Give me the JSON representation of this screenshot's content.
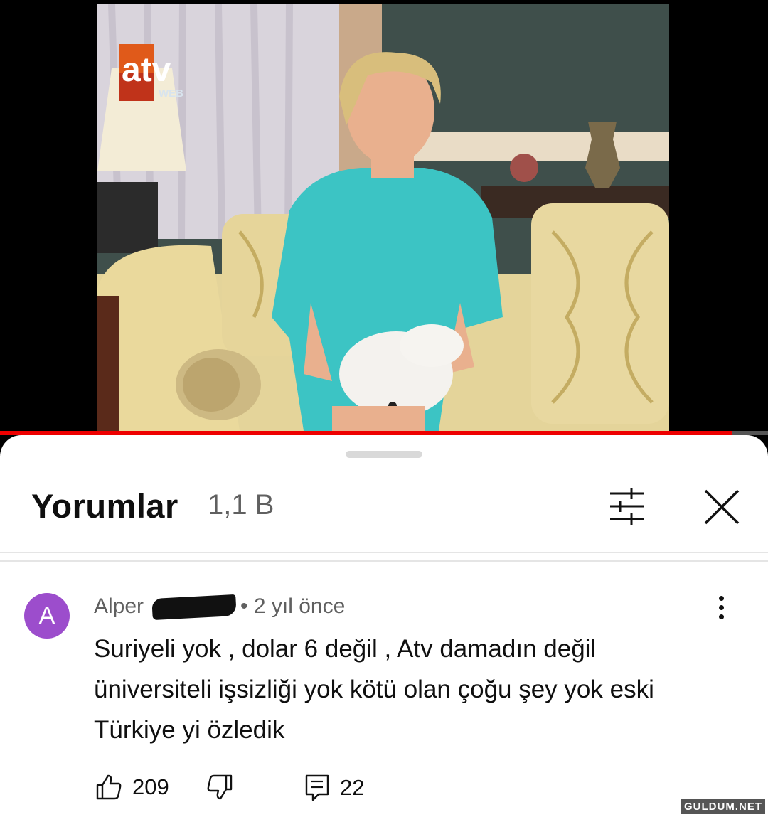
{
  "video": {
    "channel_logo_text": "atv",
    "channel_logo_sub": "WEB",
    "progress": 0.953
  },
  "comments_panel": {
    "title": "Yorumlar",
    "count": "1,1 B",
    "filter_icon": "sort-filter-icon",
    "close_icon": "close-icon"
  },
  "comment": {
    "avatar_letter": "A",
    "author_visible": "Alper",
    "time": "2 yıl önce",
    "lines": [
      "Suriyeli yok , dolar 6 değil , Atv damadın  değil",
      "üniversiteli işsizliği yok kötü olan çoğu şey yok eski",
      "Türkiye yi özledik"
    ],
    "likes": "209",
    "replies": "22",
    "like_icon": "thumbs-up-icon",
    "dislike_icon": "thumbs-down-icon",
    "reply_icon": "reply-icon",
    "more_icon": "more-vertical-icon"
  },
  "watermark": "GULDUM.NET",
  "colors": {
    "avatar": "#9c4dcc",
    "progress": "#ee0000",
    "text_primary": "#0f0f0f",
    "text_secondary": "#606060"
  }
}
